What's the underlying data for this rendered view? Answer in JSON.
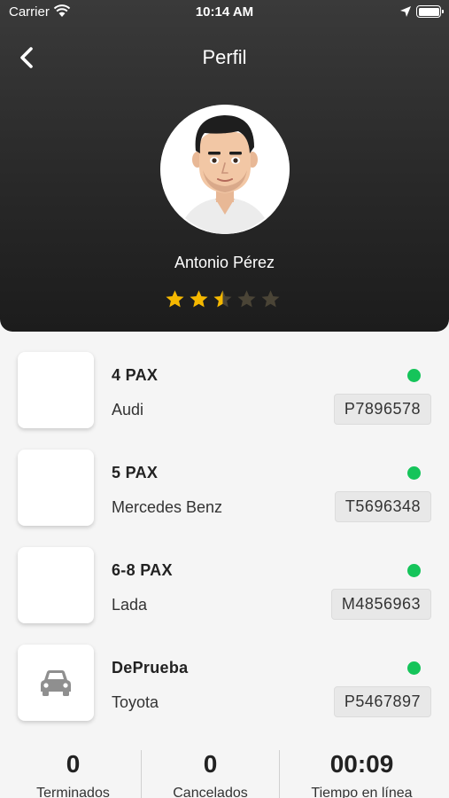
{
  "status_bar": {
    "carrier": "Carrier",
    "time": "10:14 AM"
  },
  "header": {
    "title": "Perfil"
  },
  "profile": {
    "name": "Antonio Pérez",
    "rating": 2.5,
    "rating_max": 5,
    "star_color": "#f5b800"
  },
  "vehicles": [
    {
      "capacity": "4 PAX",
      "brand": "Audi",
      "plate": "P7896578",
      "active": true,
      "has_icon": false
    },
    {
      "capacity": "5 PAX",
      "brand": "Mercedes Benz",
      "plate": "T5696348",
      "active": true,
      "has_icon": false
    },
    {
      "capacity": "6-8 PAX",
      "brand": "Lada",
      "plate": "M4856963",
      "active": true,
      "has_icon": false
    },
    {
      "capacity": "DePrueba",
      "brand": "Toyota",
      "plate": "P5467897",
      "active": true,
      "has_icon": true,
      "icon": "car-icon"
    }
  ],
  "stats": [
    {
      "value": "0",
      "label": "Terminados"
    },
    {
      "value": "0",
      "label": "Cancelados"
    },
    {
      "value": "00:09",
      "label": "Tiempo en línea"
    }
  ],
  "colors": {
    "active_dot": "#15c45a",
    "header_bg": "#2a2a2a"
  }
}
